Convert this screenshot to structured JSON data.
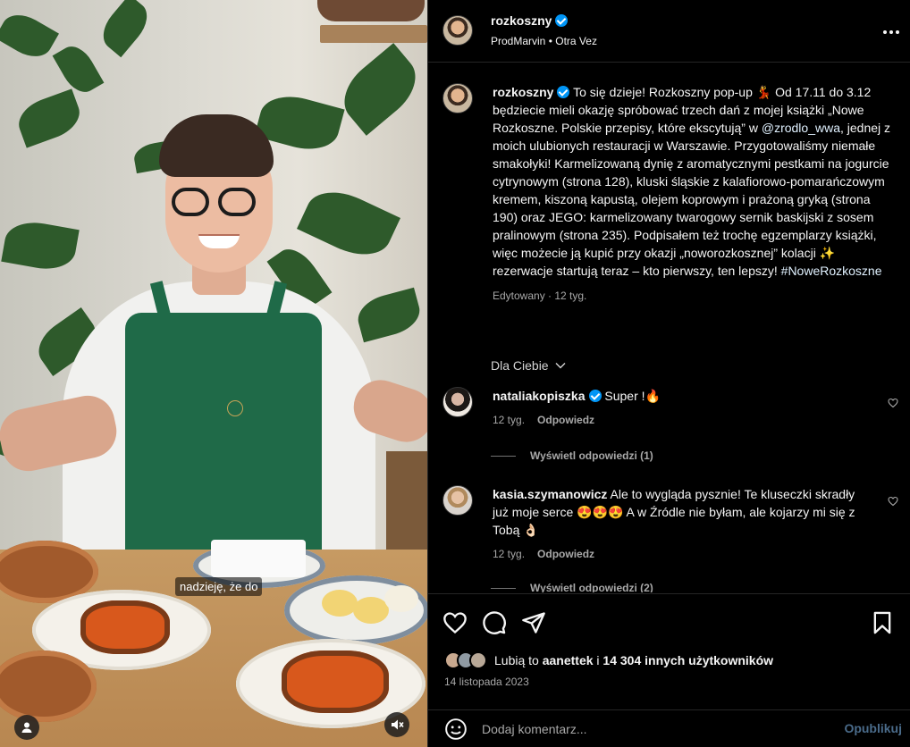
{
  "post": {
    "author": "rozkoszny",
    "author_verified": true,
    "audio_artist": "ProdMarvin",
    "audio_separator": "•",
    "audio_title": "Otra Vez",
    "more_icon": "more-horizontal-icon",
    "caption": {
      "pre_mention": "To się dzieje! Rozkoszny pop-up 💃 Od 17.11 do 3.12 będziecie mieli okazję spróbować trzech dań z mojej książki „Nowe Rozkoszne. Polskie przepisy, które ekscytują” w ",
      "mention": "@zrodlo_wwa",
      "post_mention": ", jednej z moich ulubionych restauracji w Warszawie. Przygotowaliśmy niemałe smakołyki! Karmelizowaną dynię z aromatycznymi pestkami na jogurcie cytrynowym (strona 128), kluski śląskie z kalafiorowo-pomarańczowym kremem, kiszoną kapustą, olejem koprowym i prażoną gryką (strona 190) oraz JEGO: karmelizowany twarogowy sernik baskijski z sosem pralinowym (strona 235). Podpisałem też trochę egzemplarzy książki, więc możecie ją kupić przy okazji „noworozkosznej” kolacji ✨ rezerwacje startują teraz – kto pierwszy, ten lepszy! ",
      "hashtag": "#NoweRozkoszne",
      "meta": "Edytowany · 12 tyg."
    },
    "filter_label": "Dla Ciebie",
    "comments": [
      {
        "user": "nataliakopiszka",
        "verified": true,
        "text": "Super !🔥",
        "age": "12 tyg.",
        "reply_label": "Odpowiedz",
        "view_replies": "Wyświetl odpowiedzi (1)"
      },
      {
        "user": "kasia.szymanowicz",
        "verified": false,
        "text": "Ale to wygląda pysznie! Te kluseczki skradły już moje serce 😍😍😍 A w Źródle nie byłam, ale kojarzy mi się z Tobą 👌🏻",
        "age": "12 tyg.",
        "reply_label": "Odpowiedz",
        "view_replies": "Wyświetl odpowiedzi (2)"
      }
    ],
    "likes": {
      "prefix": "Lubią to ",
      "first_user": "aanettek",
      "middle": " i ",
      "count_text": "14 304 innych użytkowników"
    },
    "date": "14 listopada 2023",
    "comment_placeholder": "Dodaj komentarz...",
    "publish_label": "Opublikuj"
  },
  "media": {
    "subtitle": "nadzieję, że do",
    "user_tag_icon": "user-icon",
    "mute_icon": "volume-muted-icon"
  },
  "colors": {
    "background": "#000000",
    "verified_badge": "#0095f6",
    "publish_inactive": "#4a6b8a",
    "secondary_text": "#a8a8a8"
  }
}
